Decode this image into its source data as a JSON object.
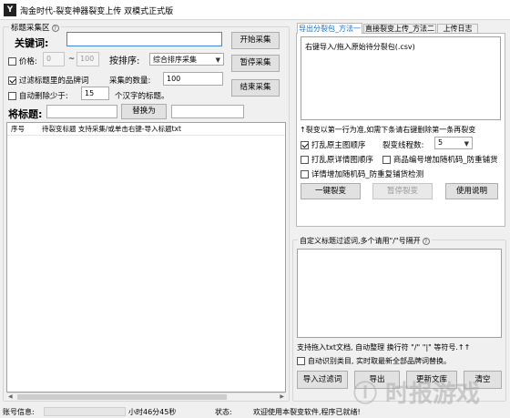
{
  "window": {
    "icon_letter": "Y",
    "title": "淘金时代-裂变神器裂变上传 双模式正式版"
  },
  "left_panel": {
    "group_title": "标题采集区",
    "keyword_label": "关键词:",
    "keyword_value": "",
    "price_label": "价格:",
    "price_min": "0",
    "price_sep": "~",
    "price_max": "100",
    "sort_label": "按排序:",
    "sort_value": "综合排序采集",
    "filter_brand_label": "过滤标题里的品牌词",
    "collect_count_label": "采集的数量:",
    "collect_count_value": "100",
    "auto_delete_label": "自动删除少于:",
    "auto_delete_value": "15",
    "auto_delete_suffix": "个汉字的标题。",
    "buttons": {
      "start": "开始采集",
      "pause": "暂停采集",
      "stop": "结束采集"
    },
    "replace_title_label": "将标题:",
    "replace_from": "",
    "replace_button": "替换为",
    "replace_to": "",
    "list_headers": {
      "col1": "序号",
      "col2": "待裂变标题 支持采集/或单击右键-导入标题txt"
    }
  },
  "right_panel": {
    "tabs": [
      "导出分裂包_方法一",
      "直接裂变上传_方法二",
      "上传日志"
    ],
    "import_hint": "右键导入/拖入原始待分裂包(.csv)",
    "instruction": "↑裂变以第一行为准,如需下条请右键删除第一条再裂变",
    "options": {
      "shuffle_main_images": "打乱原主图顺序",
      "shuffle_detail_images": "打乱原详情图顺序",
      "detail_random_code": "详情增加随机码_防重复铺货检测",
      "item_code_random": "商品编号增加随机码_防重铺货"
    },
    "fission_count_label": "裂变线程数:",
    "fission_count_value": "5",
    "buttons": {
      "fission": "一键裂变",
      "pause": "暂停裂变",
      "help": "使用说明"
    },
    "filter_group_title": "自定义标题过滤词,多个请用\"/\"号隔开",
    "filter_hint": "支持拖入txt文档, 自动整理 换行符 \"/\" \"|\" 等符号.↑↑",
    "auto_identify_label": "自动识别类目, 实时取最新全部品牌词替换。",
    "bottom_buttons": [
      "导入过滤词",
      "导出",
      "更新文库",
      "清空"
    ]
  },
  "statusbar": {
    "account_label": "账号信息:",
    "time_text": "小时46分45秒",
    "status_label": "状态:",
    "status_text": "欢迎使用本裂变软件,程序已就绪!"
  },
  "watermark": "ⓘ 时报游戏"
}
